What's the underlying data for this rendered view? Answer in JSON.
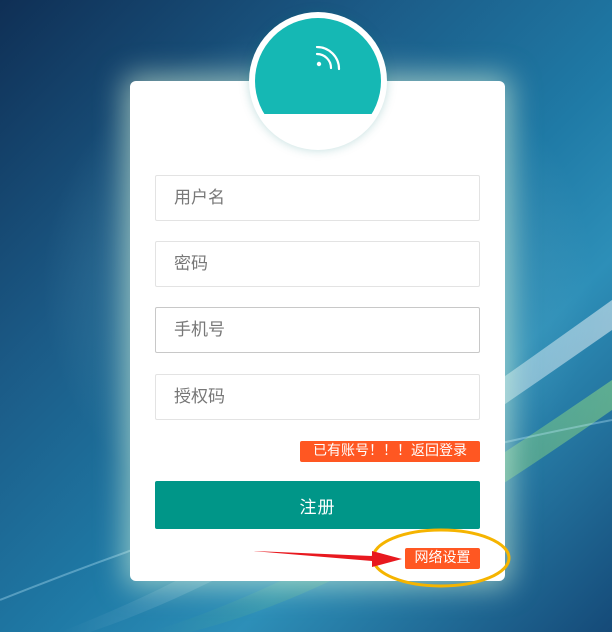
{
  "form": {
    "username_placeholder": "用户名",
    "password_placeholder": "密码",
    "phone_placeholder": "手机号",
    "authcode_placeholder": "授权码",
    "back_to_login": "已有账号！！！返回登录",
    "register_label": "注册",
    "network_settings": "网络设置"
  },
  "colors": {
    "primary": "#009688",
    "accent": "#ff5722",
    "avatar": "#15b8b4",
    "annotation_circle": "#f5b400",
    "annotation_arrow": "#e8191f"
  },
  "icons": {
    "avatar": "signal-icon"
  }
}
